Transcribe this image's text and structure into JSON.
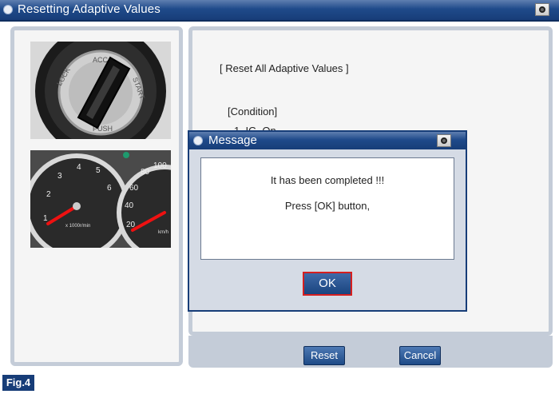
{
  "window": {
    "title": "Resetting Adaptive Values"
  },
  "procedure": {
    "heading": "[ Reset All Adaptive Values ]",
    "condition_label": "[Condition]",
    "condition_item_partial": "1. IG. On"
  },
  "images": {
    "ignition_switch": {
      "positions": [
        "LOCK",
        "ACC",
        "START",
        "PUSH"
      ]
    },
    "instrument_cluster": {
      "tachometer_numbers": [
        "1",
        "2",
        "3",
        "4",
        "5",
        "6"
      ],
      "tachometer_unit": "x 1000r/min",
      "speedometer_numbers": [
        "20",
        "40",
        "60",
        "80",
        "100"
      ],
      "speedometer_unit": "km/h"
    }
  },
  "buttons": {
    "reset_label": "Reset",
    "cancel_label": "Cancel"
  },
  "dialog": {
    "title": "Message",
    "line1": "It has been completed !!!",
    "line2": "Press [OK] button,",
    "ok_label": "OK"
  },
  "figure_label": "Fig.4",
  "colors": {
    "title_bar": "#1f4a8a",
    "panel_border": "#c4ccd8",
    "ok_highlight": "#d61f1f"
  }
}
